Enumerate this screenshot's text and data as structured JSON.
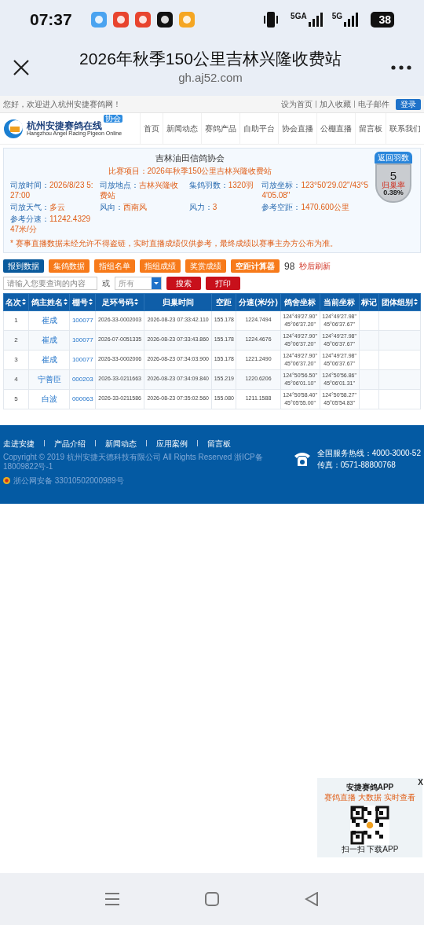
{
  "status_bar": {
    "time": "07:37",
    "network_labels": [
      "5GA",
      "5G"
    ],
    "battery": "38"
  },
  "browser": {
    "title": "2026年秋季150公里吉林兴隆收费站",
    "url": "gh.aj52.com"
  },
  "top_bar": {
    "greeting": "您好，欢迎进入杭州安捷赛鸽网！",
    "links": [
      "设为首页",
      "加入收藏",
      "电子邮件"
    ],
    "login": "登录"
  },
  "site_header": {
    "logo_title": "杭州安捷赛鸽在线",
    "logo_subtitle": "Hangzhou Angel Racing Pigeon Online",
    "logo_badge": "协会",
    "nav": [
      "首页",
      "新闻动态",
      "赛鸽产品",
      "自助平台",
      "协会直播",
      "公棚直播",
      "留言板",
      "联系我们"
    ]
  },
  "race_panel": {
    "association": "吉林油田信鸽协会",
    "event": "比赛项目：2026年秋季150公里吉林兴隆收费站",
    "fields": [
      {
        "label": "司放时间：",
        "value": "2026/8/23 5:27:00"
      },
      {
        "label": "司放地点：",
        "value": "吉林兴隆收费站"
      },
      {
        "label": "集鸽羽数：",
        "value": "1320羽"
      },
      {
        "label": "司放坐标：",
        "value": "123°50'29.02\"/43°54'05.08\""
      },
      {
        "label": "司放天气：",
        "value": "多云"
      },
      {
        "label": "风向：",
        "value": "西南风"
      },
      {
        "label": "风力：",
        "value": "3"
      },
      {
        "label": "参考空距：",
        "value": "1470.600公里"
      },
      {
        "label": "参考分速：",
        "value": "11242.432947米/分"
      }
    ],
    "notice": "* 赛事直播数据未经允许不得盗链，实时直播成绩仅供参考，最终成绩以赛事主办方公布为准。",
    "returns": {
      "title": "返回羽数",
      "count": "5",
      "rate_label": "归巢率",
      "rate": "0.38%"
    }
  },
  "toolbar": {
    "tabs": [
      {
        "label": "报到数据",
        "kind": "tab",
        "selected": true
      },
      {
        "label": "集鸽数据",
        "kind": "tab",
        "selected": false
      },
      {
        "label": "指组名单",
        "kind": "tab",
        "selected": false
      },
      {
        "label": "指组成绩",
        "kind": "tab",
        "selected": false
      },
      {
        "label": "奖赏成绩",
        "kind": "tab",
        "selected": false
      },
      {
        "label": "空距计算器",
        "kind": "tool",
        "selected": false
      }
    ],
    "countdown": "98",
    "countdown_label": "秒后刷新",
    "search_placeholder": "请输入您要查询的内容",
    "or_label": "或",
    "select_value": "所有",
    "buttons": [
      "搜索",
      "打印"
    ]
  },
  "table": {
    "columns": [
      {
        "label": "名次",
        "sortable": true
      },
      {
        "label": "鸽主姓名",
        "sortable": true
      },
      {
        "label": "棚号",
        "sortable": true
      },
      {
        "label": "足环号码",
        "sortable": true
      },
      {
        "label": "归巢时间",
        "sortable": false
      },
      {
        "label": "空距",
        "sortable": false
      },
      {
        "label": "分速(米/分)",
        "sortable": false
      },
      {
        "label": "鸽舍坐标",
        "sortable": false
      },
      {
        "label": "当前坐标",
        "sortable": false
      },
      {
        "label": "标记",
        "sortable": false
      },
      {
        "label": "团体组别",
        "sortable": true
      }
    ],
    "rows": [
      {
        "rank": "1",
        "owner": "崔成",
        "loft": "100077",
        "ring": "2026-33-0002003",
        "time": "2026-08-23 07:33:42.110",
        "distance": "155.178",
        "speed": "1224.7494",
        "loft_coord": [
          "124°49'27.90\"",
          "45°06'37.20\""
        ],
        "current_coord": [
          "124°49'27.98\"",
          "45°06'37.67\""
        ]
      },
      {
        "rank": "2",
        "owner": "崔成",
        "loft": "100077",
        "ring": "2026-07-0051335",
        "time": "2026-08-23 07:33:43.860",
        "distance": "155.178",
        "speed": "1224.4676",
        "loft_coord": [
          "124°49'27.90\"",
          "45°06'37.20\""
        ],
        "current_coord": [
          "124°49'27.98\"",
          "45°06'37.67\""
        ]
      },
      {
        "rank": "3",
        "owner": "崔成",
        "loft": "100077",
        "ring": "2026-33-0002006",
        "time": "2026-08-23 07:34:03.900",
        "distance": "155.178",
        "speed": "1221.2490",
        "loft_coord": [
          "124°49'27.90\"",
          "45°06'37.20\""
        ],
        "current_coord": [
          "124°49'27.98\"",
          "45°06'37.67\""
        ]
      },
      {
        "rank": "4",
        "owner": "宁善臣",
        "loft": "000203",
        "ring": "2026-33-0211663",
        "time": "2026-08-23 07:34:09.840",
        "distance": "155.219",
        "speed": "1220.6206",
        "loft_coord": [
          "124°50'56.50\"",
          "45°06'01.10\""
        ],
        "current_coord": [
          "124°50'56.86\"",
          "45°06'01.31\""
        ]
      },
      {
        "rank": "5",
        "owner": "白波",
        "loft": "000063",
        "ring": "2026-33-0211586",
        "time": "2026-08-23 07:35:02.560",
        "distance": "155.080",
        "speed": "1211.1588",
        "loft_coord": [
          "124°50'58.40\"",
          "45°05'55.00\""
        ],
        "current_coord": [
          "124°50'58.27\"",
          "45°05'54.83\""
        ]
      }
    ]
  },
  "footer": {
    "links": [
      "走进安捷",
      "产品介绍",
      "新闻动态",
      "应用案例",
      "留言板"
    ],
    "copyright": "Copyright © 2019 杭州安捷天德科技有限公司 All Rights Reserved 浙ICP备18009822号-1",
    "police_record": "浙公网安备 33010502000989号",
    "hotline": "全国服务热线：4000-3000-52",
    "fax": "传真：0571-88800768"
  },
  "app_popup": {
    "title": "安捷赛鸽APP",
    "tagline": "赛鸽直播 大数据 实时查看",
    "caption": "扫一扫 下载APP",
    "close": "X"
  }
}
